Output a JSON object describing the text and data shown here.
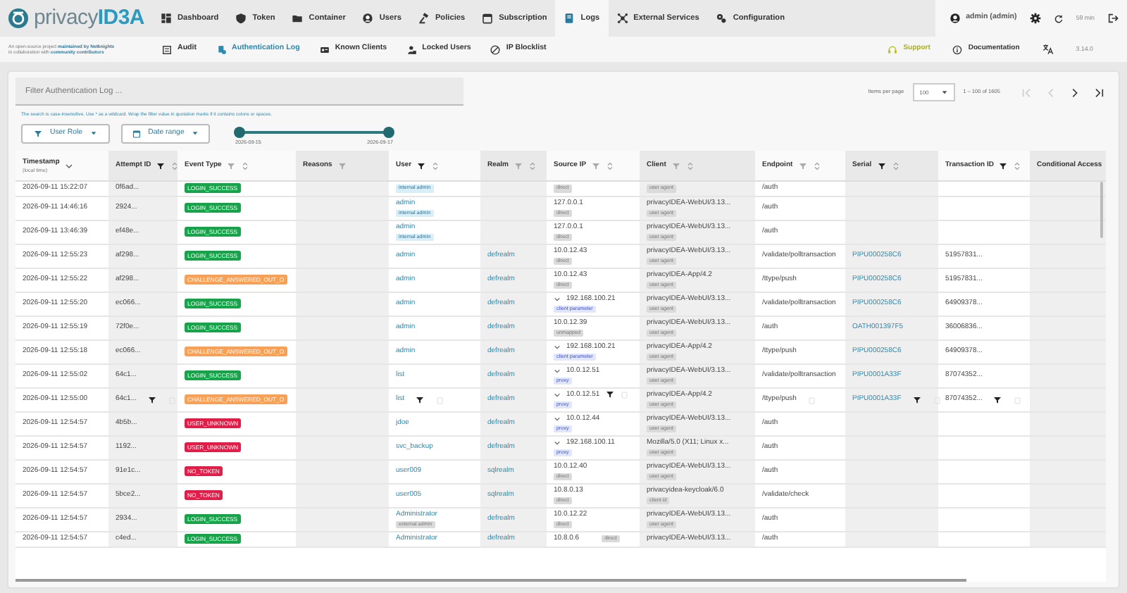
{
  "header": {
    "logo": {
      "text_1": "privacy",
      "text_2": "ID3A"
    },
    "nav": [
      {
        "label": "Dashboard",
        "selected": false
      },
      {
        "label": "Token",
        "selected": false
      },
      {
        "label": "Container",
        "selected": false
      },
      {
        "label": "Users",
        "selected": false
      },
      {
        "label": "Policies",
        "selected": false
      },
      {
        "label": "Subscription",
        "selected": false
      },
      {
        "label": "Logs",
        "selected": true
      },
      {
        "label": "External Services",
        "selected": false
      },
      {
        "label": "Configuration",
        "selected": false
      }
    ],
    "user": "admin (admin)",
    "session": "59 min"
  },
  "subheader": {
    "tagline": [
      {
        "text": "An open-source project",
        "link": "maintained by Netknights"
      },
      {
        "text": "in collaboration with",
        "link": "community contributors"
      }
    ],
    "subnav": [
      {
        "label": "Audit",
        "selected": false
      },
      {
        "label": "Authentication Log",
        "selected": true
      },
      {
        "label": "Known Clients",
        "selected": false
      },
      {
        "label": "Locked Users",
        "selected": false
      },
      {
        "label": "IP Blocklist",
        "selected": false
      }
    ],
    "support": "Support",
    "documentation": "Documentation",
    "version": "3.14.0"
  },
  "filter": {
    "placeholder": "Filter Authentication Log ...",
    "hint": "The search is case-insensitive. Use * as a wildcard. Wrap the filter value in quotation marks if it contains colons or spaces."
  },
  "filter_buttons": [
    "User Role",
    "Date range"
  ],
  "date_slider": {
    "thumbs": [
      {
        "level": 0
      },
      {
        "level": 1
      }
    ],
    "start_label": "2026-09-15",
    "end_label": "2026-09-17"
  },
  "pagination": {
    "label": "Items per page",
    "page_size": "100",
    "range": "1 – 100 of 1605",
    "buttons": [
      {
        "kind": "first",
        "disabled": true
      },
      {
        "kind": "prev",
        "disabled": true
      },
      {
        "kind": "next",
        "disabled": false
      },
      {
        "kind": "last",
        "disabled": false
      }
    ]
  },
  "table": {
    "columns": [
      {
        "label": "Timestamp",
        "sublabel": "(local time)",
        "sorted": true
      },
      {
        "label": "Attempt ID",
        "filter": true,
        "filter_active": true,
        "sortable": true
      },
      {
        "label": "Event Type",
        "filter": true,
        "filter_active": false,
        "sortable": true
      },
      {
        "label": "Reasons",
        "filter": true,
        "filter_active": false
      },
      {
        "label": "User",
        "filter": true,
        "filter_active": true,
        "sortable": true
      },
      {
        "label": "Realm",
        "filter": true,
        "filter_active": false,
        "sortable": true
      },
      {
        "label": "Source IP",
        "filter": true,
        "filter_active": false,
        "sortable": true
      },
      {
        "label": "Client",
        "filter": true,
        "filter_active": false,
        "sortable": true
      },
      {
        "label": "Endpoint",
        "filter": true,
        "filter_active": false,
        "sortable": true
      },
      {
        "label": "Serial",
        "filter": true,
        "filter_active": true,
        "sortable": true
      },
      {
        "label": "Transaction ID",
        "filter": true,
        "filter_active": true,
        "sortable": true
      },
      {
        "label": "Conditional Access"
      }
    ],
    "rows": [
      {
        "partial": true,
        "timestamp": "2026-09-11 15:22:07",
        "attempt_id": "0f6ad...",
        "event": {
          "label": "LOGIN_SUCCESS",
          "color": "#16a34a"
        },
        "user_tag": {
          "label": "internal admin",
          "kind": "info"
        },
        "source_ip": {
          "tag": {
            "label": "direct",
            "kind": "neutral"
          }
        },
        "client": {
          "tag": {
            "label": "user agent",
            "kind": "neutral"
          }
        },
        "endpoint": "/auth"
      },
      {
        "timestamp": "2026-09-11 14:46:16",
        "attempt_id": "2924...",
        "event": {
          "label": "LOGIN_SUCCESS",
          "color": "#16a34a"
        },
        "user": "admin",
        "user_tag": {
          "label": "internal admin",
          "kind": "info"
        },
        "source_ip": {
          "address": "127.0.0.1",
          "tag": {
            "label": "direct",
            "kind": "neutral"
          }
        },
        "client": {
          "name": "privacyIDEA-WebUI/3.13...",
          "tag": {
            "label": "user agent",
            "kind": "neutral"
          }
        },
        "endpoint": "/auth"
      },
      {
        "timestamp": "2026-09-11 13:46:39",
        "attempt_id": "ef48e...",
        "event": {
          "label": "LOGIN_SUCCESS",
          "color": "#16a34a"
        },
        "user": "admin",
        "user_tag": {
          "label": "internal admin",
          "kind": "info"
        },
        "source_ip": {
          "address": "127.0.0.1",
          "tag": {
            "label": "direct",
            "kind": "neutral"
          }
        },
        "client": {
          "name": "privacyIDEA-WebUI/3.13...",
          "tag": {
            "label": "user agent",
            "kind": "neutral"
          }
        },
        "endpoint": "/auth"
      },
      {
        "timestamp": "2026-09-11 12:55:23",
        "attempt_id": "af298...",
        "event": {
          "label": "LOGIN_SUCCESS",
          "color": "#16a34a"
        },
        "user": "admin",
        "realm": "defrealm",
        "source_ip": {
          "address": "10.0.12.43",
          "tag": {
            "label": "direct",
            "kind": "neutral"
          }
        },
        "client": {
          "name": "privacyIDEA-WebUI/3.13...",
          "tag": {
            "label": "user agent",
            "kind": "neutral"
          }
        },
        "endpoint": "/validate/polltransaction",
        "serial": "PIPU000258C6",
        "transaction_id": "51957831..."
      },
      {
        "timestamp": "2026-09-11 12:55:22",
        "attempt_id": "af298...",
        "event": {
          "label": "CHALLENGE_ANSWERED_OUT_O",
          "color": "#f7a056"
        },
        "user": "admin",
        "realm": "defrealm",
        "source_ip": {
          "address": "10.0.12.43",
          "tag": {
            "label": "direct",
            "kind": "neutral"
          }
        },
        "client": {
          "name": "privacyIDEA-App/4.2",
          "tag": {
            "label": "user agent",
            "kind": "neutral"
          }
        },
        "endpoint": "/ttype/push",
        "serial": "PIPU000258C6",
        "transaction_id": "51957831..."
      },
      {
        "timestamp": "2026-09-11 12:55:20",
        "attempt_id": "ec066...",
        "event": {
          "label": "LOGIN_SUCCESS",
          "color": "#16a34a"
        },
        "user": "admin",
        "realm": "defrealm",
        "source_ip": {
          "expandable": true,
          "address": "192.168.100.21",
          "tag": {
            "label": "client parameter",
            "kind": "accent"
          }
        },
        "client": {
          "name": "privacyIDEA-WebUI/3.13...",
          "tag": {
            "label": "user agent",
            "kind": "neutral"
          }
        },
        "endpoint": "/validate/polltransaction",
        "serial": "PIPU000258C6",
        "transaction_id": "64909378..."
      },
      {
        "timestamp": "2026-09-11 12:55:19",
        "attempt_id": "72f0e...",
        "event": {
          "label": "LOGIN_SUCCESS",
          "color": "#16a34a"
        },
        "user": "admin",
        "realm": "defrealm",
        "source_ip": {
          "address": "10.0.12.39",
          "tag": {
            "label": "unmapped",
            "kind": "neutral"
          }
        },
        "client": {
          "name": "privacyIDEA-WebUI/3.13...",
          "tag": {
            "label": "user agent",
            "kind": "neutral"
          }
        },
        "endpoint": "/auth",
        "serial": "OATH001397F5",
        "transaction_id": "36006836..."
      },
      {
        "timestamp": "2026-09-11 12:55:18",
        "attempt_id": "ec066...",
        "event": {
          "label": "CHALLENGE_ANSWERED_OUT_O",
          "color": "#f7a056"
        },
        "user": "admin",
        "realm": "defrealm",
        "source_ip": {
          "expandable": true,
          "address": "192.168.100.21",
          "tag": {
            "label": "client parameter",
            "kind": "accent"
          }
        },
        "client": {
          "name": "privacyIDEA-App/4.2",
          "tag": {
            "label": "user agent",
            "kind": "neutral"
          }
        },
        "endpoint": "/ttype/push",
        "serial": "PIPU000258C6",
        "transaction_id": "64909378..."
      },
      {
        "timestamp": "2026-09-11 12:55:02",
        "attempt_id": "64c1...",
        "event": {
          "label": "LOGIN_SUCCESS",
          "color": "#16a34a"
        },
        "user": "list",
        "realm": "defrealm",
        "source_ip": {
          "expandable": true,
          "address": "10.0.12.51",
          "tag": {
            "label": "proxy",
            "kind": "accent"
          }
        },
        "client": {
          "name": "privacyIDEA-WebUI/3.13...",
          "tag": {
            "label": "user agent",
            "kind": "neutral"
          }
        },
        "endpoint": "/validate/polltransaction",
        "serial": "PIPU0001A33F",
        "transaction_id": "87074352..."
      },
      {
        "hovered": true,
        "timestamp": "2026-09-11 12:55:00",
        "attempt_id": "64c1...",
        "event": {
          "label": "CHALLENGE_ANSWERED_OUT_O",
          "color": "#f7a056"
        },
        "user": "list",
        "realm": "defrealm",
        "source_ip": {
          "expandable": true,
          "address": "10.0.12.51",
          "tag": {
            "label": "proxy",
            "kind": "accent"
          }
        },
        "client": {
          "name": "privacyIDEA-App/4.2",
          "tag": {
            "label": "user agent",
            "kind": "neutral"
          }
        },
        "endpoint": "/ttype/push",
        "serial": "PIPU0001A33F",
        "transaction_id": "87074352..."
      },
      {
        "timestamp": "2026-09-11 12:54:57",
        "attempt_id": "4b5b...",
        "event": {
          "label": "USER_UNKNOWN",
          "color": "#e11d48"
        },
        "user": "jdoe",
        "realm": "defrealm",
        "source_ip": {
          "expandable": true,
          "address": "10.0.12.44",
          "tag": {
            "label": "proxy",
            "kind": "accent"
          }
        },
        "client": {
          "name": "privacyIDEA-WebUI/3.13...",
          "tag": {
            "label": "user agent",
            "kind": "neutral"
          }
        },
        "endpoint": "/auth"
      },
      {
        "timestamp": "2026-09-11 12:54:57",
        "attempt_id": "1192...",
        "event": {
          "label": "USER_UNKNOWN",
          "color": "#e11d48"
        },
        "user": "svc_backup",
        "realm": "defrealm",
        "source_ip": {
          "expandable": true,
          "address": "192.168.100.11",
          "tag": {
            "label": "proxy",
            "kind": "accent"
          }
        },
        "client": {
          "name": "Mozilla/5.0 (X11; Linux x...",
          "tag": {
            "label": "user agent",
            "kind": "neutral"
          }
        },
        "endpoint": "/auth"
      },
      {
        "timestamp": "2026-09-11 12:54:57",
        "attempt_id": "91e1c...",
        "event": {
          "label": "NO_TOKEN",
          "color": "#e11d48"
        },
        "user": "user009",
        "realm": "sqlrealm",
        "source_ip": {
          "address": "10.0.12.40",
          "tag": {
            "label": "direct",
            "kind": "neutral"
          }
        },
        "client": {
          "name": "privacyIDEA-WebUI/3.13...",
          "tag": {
            "label": "user agent",
            "kind": "neutral"
          }
        },
        "endpoint": "/auth"
      },
      {
        "timestamp": "2026-09-11 12:54:57",
        "attempt_id": "5bce2...",
        "event": {
          "label": "NO_TOKEN",
          "color": "#e11d48"
        },
        "user": "user005",
        "realm": "sqlrealm",
        "source_ip": {
          "address": "10.8.0.13",
          "tag": {
            "label": "direct",
            "kind": "neutral"
          }
        },
        "client": {
          "name": "privacyidea-keycloak/6.0",
          "tag": {
            "label": "client id",
            "kind": "neutral"
          }
        },
        "endpoint": "/validate/check"
      },
      {
        "timestamp": "2026-09-11 12:54:57",
        "attempt_id": "2934...",
        "event": {
          "label": "LOGIN_SUCCESS",
          "color": "#16a34a"
        },
        "user": "Administrator",
        "user_tag": {
          "label": "external admin",
          "kind": "neutral"
        },
        "realm": "defrealm",
        "source_ip": {
          "address": "10.0.12.22",
          "tag": {
            "label": "direct",
            "kind": "neutral"
          }
        },
        "client": {
          "name": "privacyIDEA-WebUI/3.13...",
          "tag": {
            "label": "user agent",
            "kind": "neutral"
          }
        },
        "endpoint": "/auth"
      },
      {
        "timestamp": "2026-09-11 12:54:57",
        "attempt_id": "c4ed...",
        "event": {
          "label": "LOGIN_SUCCESS",
          "color": "#16a34a"
        },
        "user": "Administrator",
        "realm": "defrealm",
        "source_ip": {
          "address": "10.8.0.6",
          "tag_inline": true,
          "tag": {
            "label": "direct",
            "kind": "neutral"
          }
        },
        "client": {
          "name": "privacyIDEA-WebUI/3.13..."
        },
        "endpoint": "/auth"
      }
    ]
  }
}
